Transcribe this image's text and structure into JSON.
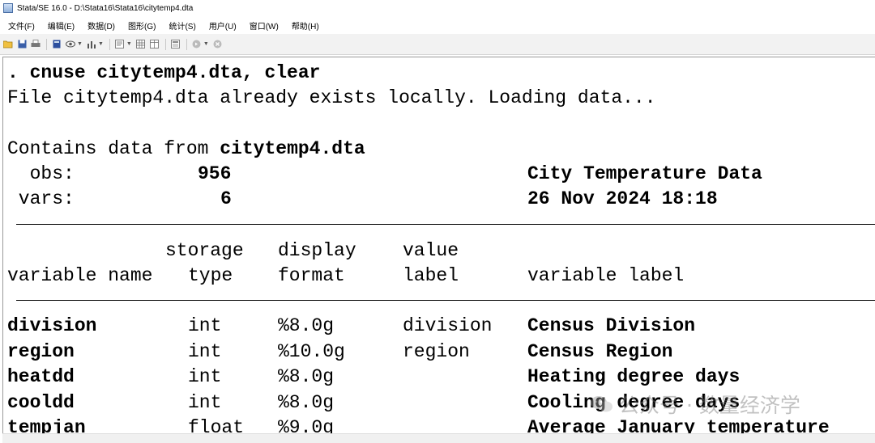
{
  "window": {
    "title": "Stata/SE 16.0 - D:\\Stata16\\Stata16\\citytemp4.dta"
  },
  "menu": {
    "items": [
      {
        "label": "文件(F)"
      },
      {
        "label": "编辑(E)"
      },
      {
        "label": "数据(D)"
      },
      {
        "label": "图形(G)"
      },
      {
        "label": "统计(S)"
      },
      {
        "label": "用户(U)"
      },
      {
        "label": "窗口(W)"
      },
      {
        "label": "帮助(H)"
      }
    ]
  },
  "toolbar": {
    "icons": [
      "open-icon",
      "save-icon",
      "print-icon",
      "log-icon",
      "viewer-icon",
      "graph-icon",
      "dofile-editor-icon",
      "data-editor-icon",
      "data-browser-icon",
      "variables-manager-icon",
      "more-icon",
      "break-icon"
    ]
  },
  "results": {
    "command": ". cnuse citytemp4.dta, clear",
    "loading_message": "File citytemp4.dta already exists locally. Loading data...",
    "contains_prefix": "Contains data from ",
    "contains_file": "citytemp4.dta",
    "obs_label": "  obs:",
    "obs_value": "956",
    "dataset_label": "City Temperature Data",
    "vars_label": " vars:",
    "vars_value": "6",
    "dataset_date": "26 Nov 2024 18:18",
    "headers": {
      "storage": "storage",
      "display": "display",
      "value": "value",
      "variable_name": "variable name",
      "type": "type",
      "format": "format",
      "label": "label",
      "variable_label": "variable label"
    },
    "variables": [
      {
        "name": "division",
        "type": "int",
        "format": "%8.0g",
        "value_label": "division",
        "label": "Census Division"
      },
      {
        "name": "region",
        "type": "int",
        "format": "%10.0g",
        "value_label": "region",
        "label": "Census Region"
      },
      {
        "name": "heatdd",
        "type": "int",
        "format": "%8.0g",
        "value_label": "",
        "label": "Heating degree days"
      },
      {
        "name": "cooldd",
        "type": "int",
        "format": "%8.0g",
        "value_label": "",
        "label": "Cooling degree days"
      },
      {
        "name": "tempjan",
        "type": "float",
        "format": "%9.0g",
        "value_label": "",
        "label": "Average January temperature"
      }
    ]
  },
  "watermark": {
    "text": "公众号 · 数量经济学"
  }
}
